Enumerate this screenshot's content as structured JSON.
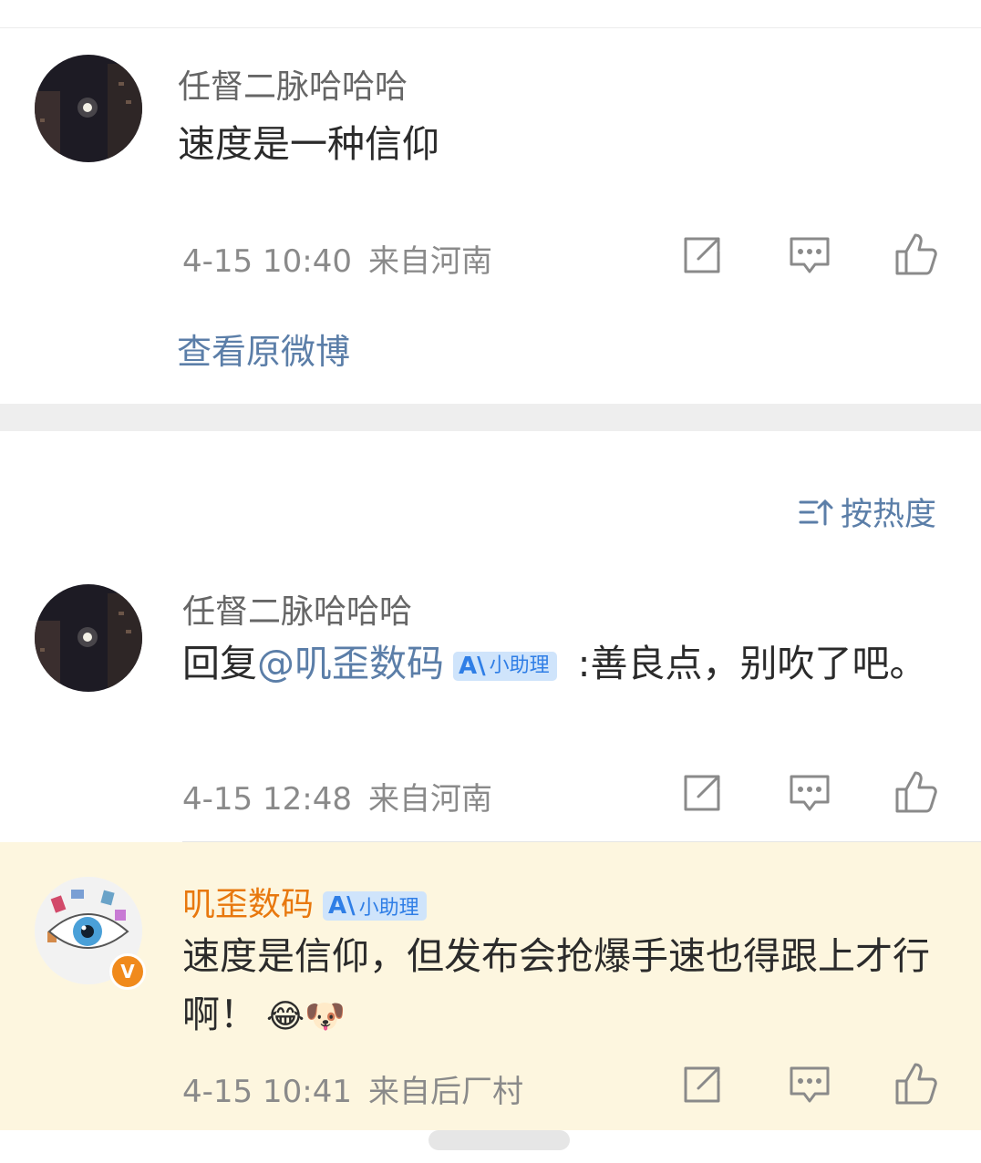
{
  "comment1": {
    "username": "任督二脉哈哈哈",
    "text": "速度是一种信仰",
    "time": "4-15 10:40",
    "location": "来自河南",
    "view_original": "查看原微博"
  },
  "sort": {
    "label": "按热度"
  },
  "reply1": {
    "username": "任督二脉哈哈哈",
    "prefix": "回复",
    "mention": "@叽歪数码",
    "badge_ai": "A\\",
    "badge_text": "小助理",
    "text_after": " :善良点，别吹了吧。",
    "time": "4-15 12:48",
    "location": "来自河南"
  },
  "reply2": {
    "username": "叽歪数码",
    "badge_ai": "A\\",
    "badge_text": "小助理",
    "text": "速度是信仰，但发布会抢爆手速也得跟上才行啊！",
    "emoji": "😂🐶",
    "time": "4-15 10:41",
    "location": "来自后厂村",
    "verified": "V"
  },
  "colors": {
    "link": "#5b7ea8",
    "highlight": "#fdf6df",
    "orange": "#e8780e"
  }
}
